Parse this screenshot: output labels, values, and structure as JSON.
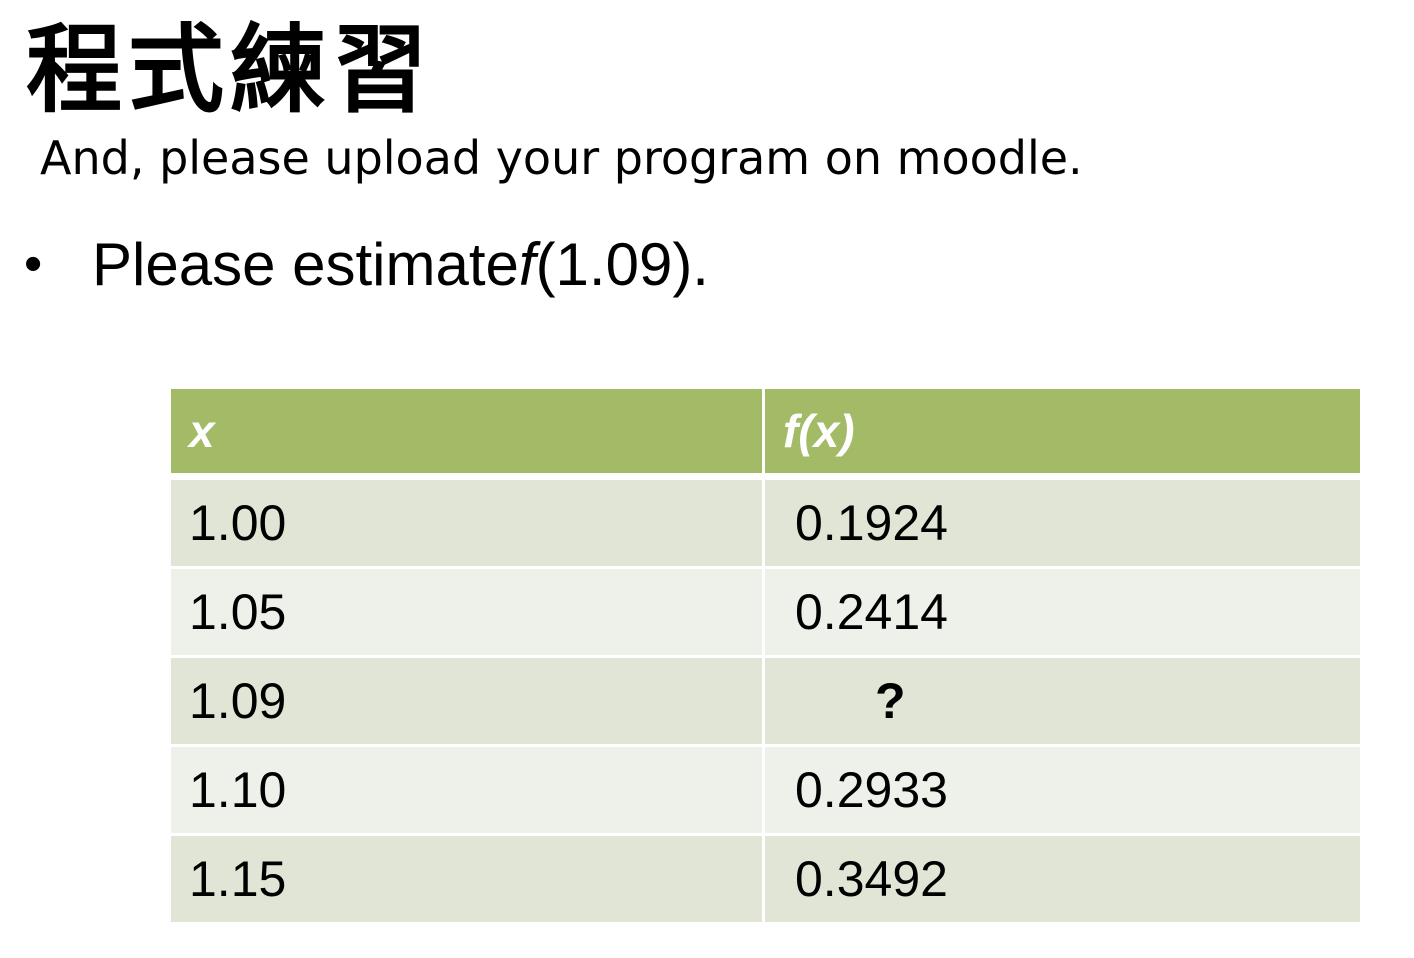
{
  "slide": {
    "title": "程式練習",
    "subtitle": "And, please upload your program on moodle.",
    "bullet": {
      "symbol": "•",
      "text_before": "Please estimate ",
      "function_name": "f",
      "text_after": "(1.09)."
    }
  },
  "table": {
    "headers": [
      "x",
      "f(x)"
    ],
    "rows": [
      {
        "x": "1.00",
        "fx": "0.1924"
      },
      {
        "x": "1.05",
        "fx": "0.2414"
      },
      {
        "x": "1.09",
        "fx": "?"
      },
      {
        "x": "1.10",
        "fx": "0.2933"
      },
      {
        "x": "1.15",
        "fx": "0.3492"
      }
    ]
  },
  "colors": {
    "header_bg": "#a3bb66",
    "row_band_dark": "#e0e5d6",
    "row_band_light": "#eef1ea",
    "header_text": "#ffffff"
  }
}
